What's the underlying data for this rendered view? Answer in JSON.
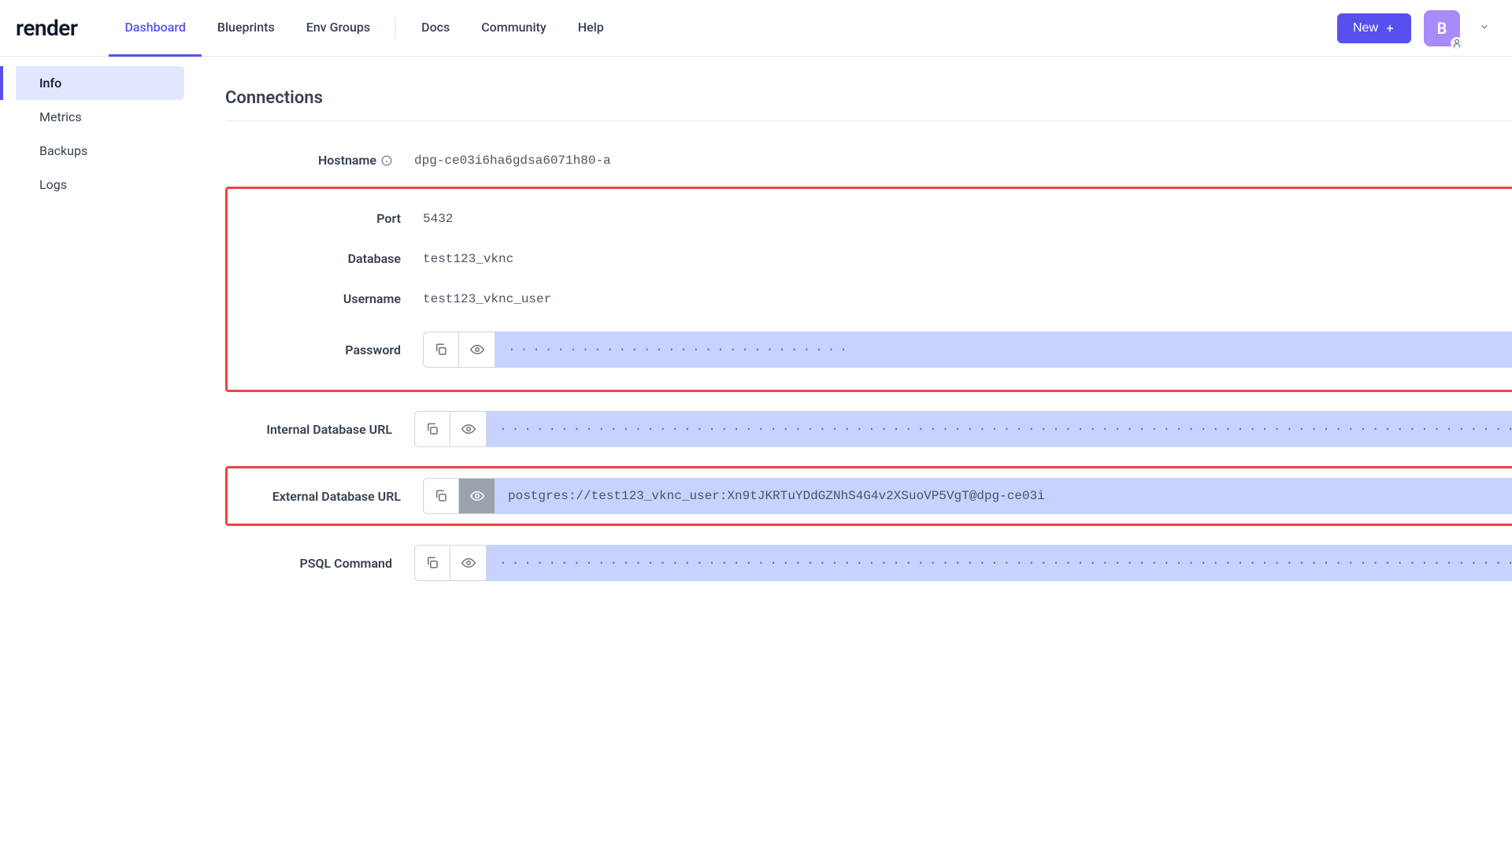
{
  "brand": "render",
  "nav": {
    "dashboard": "Dashboard",
    "blueprints": "Blueprints",
    "envGroups": "Env Groups",
    "docs": "Docs",
    "community": "Community",
    "help": "Help"
  },
  "header": {
    "newLabel": "New",
    "avatarLetter": "B"
  },
  "sidebar": {
    "info": "Info",
    "metrics": "Metrics",
    "backups": "Backups",
    "logs": "Logs"
  },
  "page": {
    "title": "Connections"
  },
  "labels": {
    "hostname": "Hostname",
    "port": "Port",
    "database": "Database",
    "username": "Username",
    "password": "Password",
    "internalUrl": "Internal Database URL",
    "externalUrl": "External Database URL",
    "psql": "PSQL Command"
  },
  "values": {
    "hostname": "dpg-ce03i6ha6gdsa6071h80-a",
    "port": "5432",
    "database": "test123_vknc",
    "username": "test123_vknc_user",
    "passwordMasked": "····························",
    "internalUrlMasked": "································································································",
    "externalUrl": "postgres://test123_vknc_user:Xn9tJKRTuYDdGZNhS4G4v2XSuoVP5VgT@dpg-ce03i",
    "psqlMasked": "································································································"
  }
}
